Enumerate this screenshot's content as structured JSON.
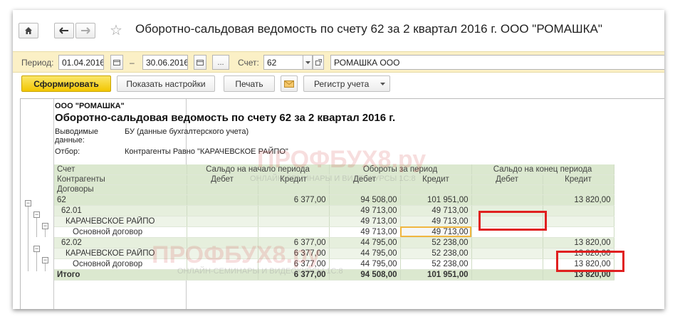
{
  "window": {
    "title": "Оборотно-сальдовая ведомость по счету 62 за 2 квартал 2016 г. ООО \"РОМАШКА\""
  },
  "period_bar": {
    "period_label": "Период:",
    "date_from": "01.04.2016",
    "dash": "–",
    "date_to": "30.06.2016",
    "ellipsis": "...",
    "account_label": "Счет:",
    "account": "62",
    "organization": "РОМАШКА ООО"
  },
  "toolbar": {
    "generate": "Сформировать",
    "show_settings": "Показать настройки",
    "print": "Печать",
    "register": "Регистр учета"
  },
  "report": {
    "org": "ООО \"РОМАШКА\"",
    "title": "Оборотно-сальдовая ведомость по счету 62 за 2 квартал 2016 г.",
    "output_label": "Выводимые данные:",
    "output_value": "БУ (данные бухгалтерского учета)",
    "filter_label": "Отбор:",
    "filter_value": "Контрагенты Равно \"КАРАЧЕВСКОЕ РАЙПО\"",
    "headers": {
      "account": "Счет",
      "counterparty": "Контрагенты",
      "contracts": "Договоры",
      "opening": "Сальдо на начало периода",
      "turnover": "Обороты за период",
      "closing": "Сальдо на конец периода",
      "debit": "Дебет",
      "credit": "Кредит"
    },
    "rows": [
      {
        "name": "62",
        "od": "",
        "oc": "6 377,00",
        "td": "94 508,00",
        "tc": "101 951,00",
        "cd": "",
        "cc": "13 820,00"
      },
      {
        "name": "62.01",
        "od": "",
        "oc": "",
        "td": "49 713,00",
        "tc": "49 713,00",
        "cd": "",
        "cc": ""
      },
      {
        "name": "КАРАЧЕВСКОЕ РАЙПО",
        "od": "",
        "oc": "",
        "td": "49 713,00",
        "tc": "49 713,00",
        "cd": "",
        "cc": ""
      },
      {
        "name": "Основной договор",
        "od": "",
        "oc": "",
        "td": "49 713,00",
        "tc": "49 713,00",
        "cd": "",
        "cc": ""
      },
      {
        "name": "62.02",
        "od": "",
        "oc": "6 377,00",
        "td": "44 795,00",
        "tc": "52 238,00",
        "cd": "",
        "cc": "13 820,00"
      },
      {
        "name": "КАРАЧЕВСКОЕ РАЙПО",
        "od": "",
        "oc": "6 377,00",
        "td": "44 795,00",
        "tc": "52 238,00",
        "cd": "",
        "cc": "13 820,00"
      },
      {
        "name": "Основной договор",
        "od": "",
        "oc": "6 377,00",
        "td": "44 795,00",
        "tc": "52 238,00",
        "cd": "",
        "cc": "13 820,00"
      }
    ],
    "total": {
      "name": "Итого",
      "od": "",
      "oc": "6 377,00",
      "td": "94 508,00",
      "tc": "101 951,00",
      "cd": "",
      "cc": "13 820,00"
    }
  },
  "watermark": {
    "brand": "ПРОФБУХ8.ру",
    "tagline": "ОНЛАЙН-СЕМИНАРЫ И ВИДЕОКУРСЫ 1С:8"
  },
  "colors": {
    "primary_button": "#f2c600",
    "period_bar": "#fbf0c6",
    "group_row": "#dbe8cf",
    "highlight": "#e02020",
    "selected_cell": "#f0b640"
  }
}
